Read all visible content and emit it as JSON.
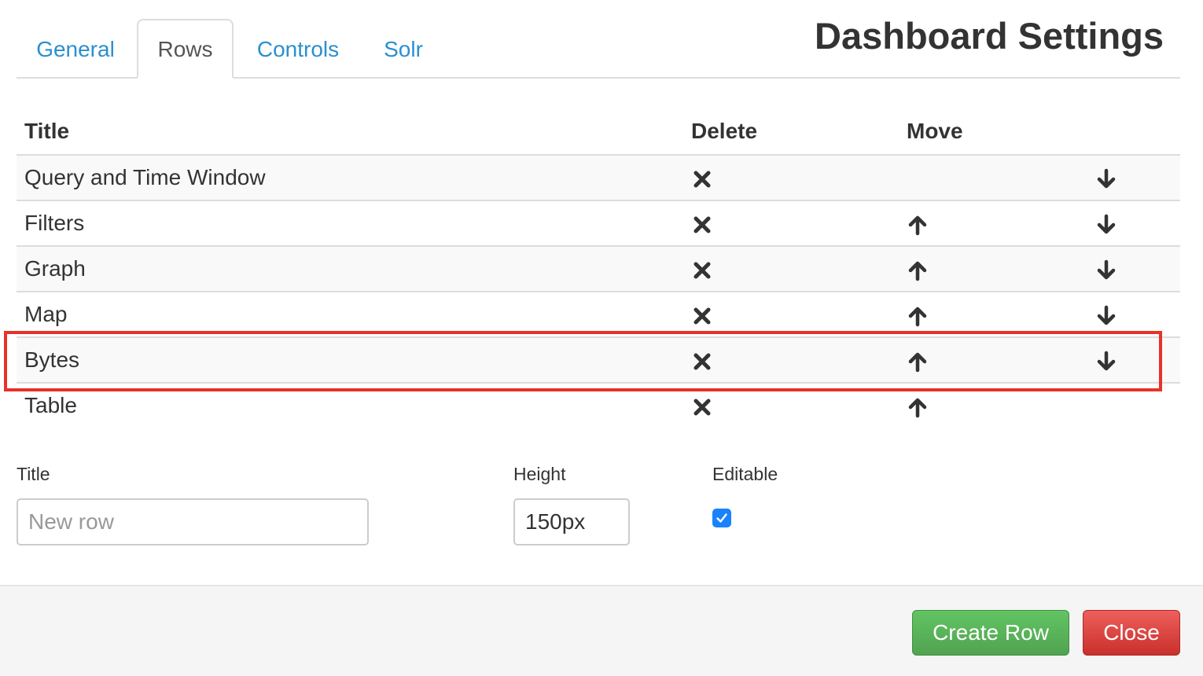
{
  "page_title": "Dashboard Settings",
  "tabs": [
    {
      "label": "General",
      "active": false
    },
    {
      "label": "Rows",
      "active": true
    },
    {
      "label": "Controls",
      "active": false
    },
    {
      "label": "Solr",
      "active": false
    }
  ],
  "table": {
    "headers": {
      "title": "Title",
      "delete": "Delete",
      "move": "Move"
    },
    "rows": [
      {
        "title": "Query and Time Window",
        "icons": [
          "times-icon",
          "arrow-down-icon"
        ],
        "highlighted": false
      },
      {
        "title": "Filters",
        "icons": [
          "times-icon",
          "arrow-up-icon",
          "arrow-down-icon"
        ],
        "highlighted": false
      },
      {
        "title": "Graph",
        "icons": [
          "times-icon",
          "arrow-up-icon",
          "arrow-down-icon"
        ],
        "highlighted": false
      },
      {
        "title": "Map",
        "icons": [
          "times-icon",
          "arrow-up-icon",
          "arrow-down-icon"
        ],
        "highlighted": false
      },
      {
        "title": "Bytes",
        "icons": [
          "times-icon",
          "arrow-up-icon",
          "arrow-down-icon"
        ],
        "highlighted": true
      },
      {
        "title": "Table",
        "icons": [
          "times-icon",
          "arrow-up-icon"
        ],
        "highlighted": false
      }
    ]
  },
  "form": {
    "title_label": "Title",
    "title_placeholder": "New row",
    "title_value": "",
    "height_label": "Height",
    "height_value": "150px",
    "editable_label": "Editable",
    "editable_checked": true
  },
  "footer": {
    "create_label": "Create Row",
    "close_label": "Close"
  },
  "colors": {
    "link": "#2a8fcf",
    "success": "#5bb75b",
    "danger": "#da4f49",
    "highlight": "#e8312a",
    "checkbox": "#1a82fb"
  }
}
